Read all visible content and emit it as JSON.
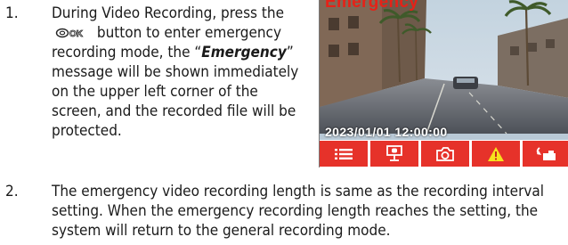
{
  "steps": [
    {
      "number": "1.",
      "before": "During Video Recording, press the",
      "after": "button to enter emergency recording mode, the “",
      "emphasis": "Emergency",
      "rest": "” message will be shown immediately on the upper left corner of the screen, and the recorded file will be protected."
    },
    {
      "number": "2.",
      "text": "The emergency video recording length is same as the recording interval setting. When the emergency recording length reaches the setting, the system will return to the general recording mode."
    }
  ],
  "ok_button_icon": "ok-button-icon",
  "screen": {
    "status_label": "Emergency",
    "timestamp": "2023/01/01  12:00:00",
    "label_color": "#e52218",
    "toolbar_color": "#e6322a",
    "toolbar_icons": [
      "menu-icon",
      "microphone-icon",
      "camera-icon",
      "warning-icon",
      "switch-camera-icon"
    ]
  }
}
